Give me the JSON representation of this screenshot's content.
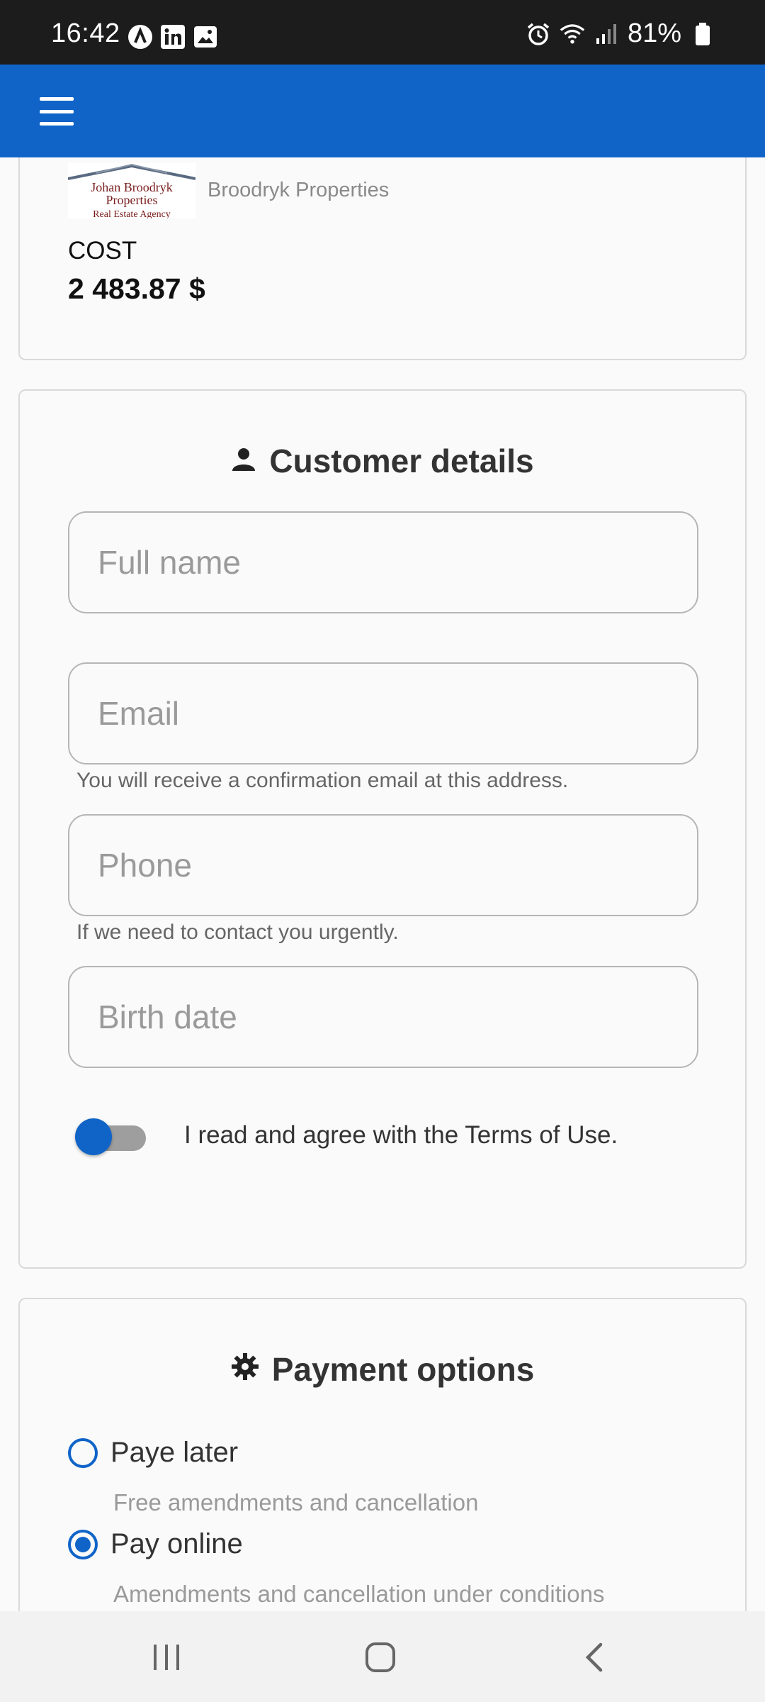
{
  "status_bar": {
    "time": "16:42",
    "battery": "81%",
    "left_icons": [
      "app-notification-icon",
      "linkedin-icon",
      "image-icon"
    ],
    "right_icons": [
      "alarm-icon",
      "wifi-icon",
      "signal-icon",
      "battery-icon"
    ]
  },
  "app_bar": {
    "menu_icon": "hamburger-menu-icon",
    "color": "#1064c8"
  },
  "property": {
    "logo_text": [
      "Johan Broodryk",
      "Properties",
      "Real Estate Agency"
    ],
    "agency_name": "Broodryk Properties",
    "cost_label": "COST",
    "cost_value": "2 483.87 $"
  },
  "customer_details": {
    "title": "Customer details",
    "title_icon": "person-icon",
    "full_name": {
      "placeholder": "Full name",
      "value": ""
    },
    "email": {
      "placeholder": "Email",
      "value": "",
      "helper": "You will receive a confirmation email at this address."
    },
    "phone": {
      "placeholder": "Phone",
      "value": "",
      "helper": "If we need to contact you urgently."
    },
    "birth_date": {
      "placeholder": "Birth date",
      "value": ""
    },
    "terms": {
      "label": "I read and agree with the Terms of Use.",
      "checked": false
    }
  },
  "payment_options": {
    "title": "Payment options",
    "title_icon": "gear-icon",
    "options": [
      {
        "label": "Paye later",
        "description": "Free amendments and cancellation",
        "selected": false
      },
      {
        "label": "Pay online",
        "description": "Amendments and cancellation under conditions",
        "selected": true
      }
    ]
  },
  "nav_bar": {
    "buttons": [
      "recent-apps-icon",
      "home-icon",
      "back-icon"
    ]
  }
}
